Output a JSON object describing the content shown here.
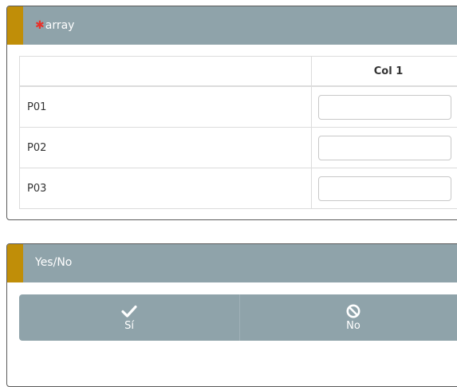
{
  "q1": {
    "required_mark": "✱",
    "title": "array",
    "columns": [
      "",
      "Col 1"
    ],
    "rows": [
      {
        "label": "P01",
        "value": ""
      },
      {
        "label": "P02",
        "value": ""
      },
      {
        "label": "P03",
        "value": ""
      }
    ]
  },
  "q2": {
    "title": "Yes/No",
    "yes_label": "Sí",
    "no_label": "No",
    "yes_icon": "checkmark-icon",
    "no_icon": "ban-icon"
  },
  "colors": {
    "header_bg": "#8fa3aa",
    "accent": "#c08e08",
    "required": "#e8312a"
  }
}
